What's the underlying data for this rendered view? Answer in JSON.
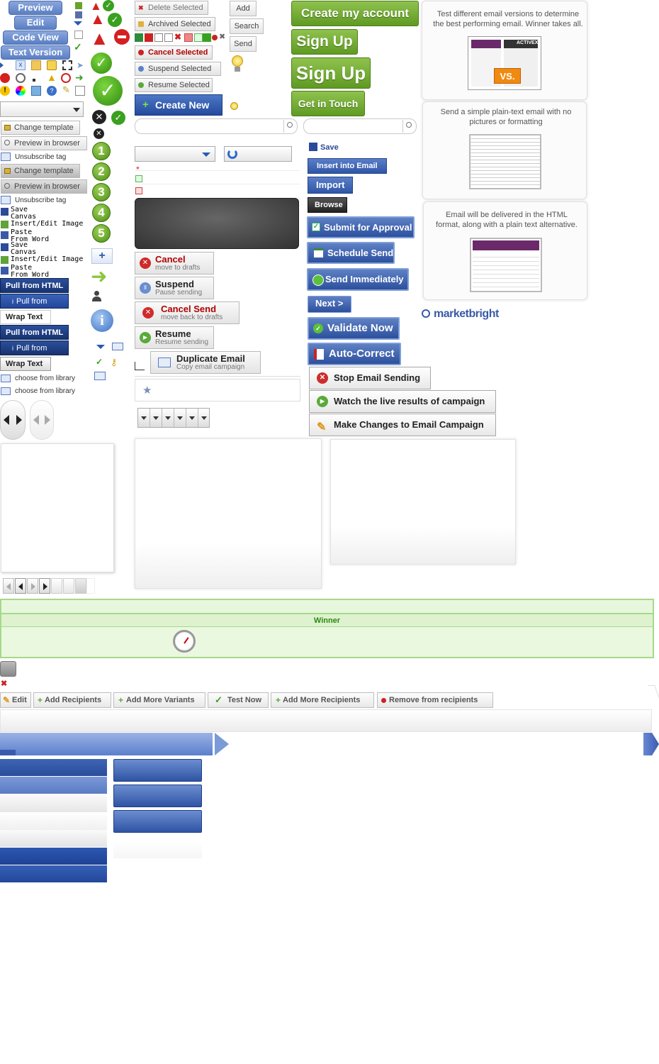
{
  "left_pills": [
    "Preview",
    "Edit",
    "Code View",
    "Text Version"
  ],
  "left_tools": [
    {
      "label": "Change template",
      "style": "light"
    },
    {
      "label": "Preview in browser",
      "style": "light"
    },
    {
      "label": "Unsubscribe tag",
      "style": "plain"
    },
    {
      "label": "Change template",
      "style": "dark"
    },
    {
      "label": "Preview in browser",
      "style": "dark"
    },
    {
      "label": "Unsubscribe tag",
      "style": "plain"
    }
  ],
  "canvas_tools": [
    {
      "l1": "Save",
      "l2": "Canvas"
    },
    {
      "l1": "Insert/Edit Image",
      "l2": ""
    },
    {
      "l1": "Paste",
      "l2": "From Word"
    },
    {
      "l1": "Save",
      "l2": "Canvas"
    },
    {
      "l1": "Insert/Edit Image",
      "l2": ""
    },
    {
      "l1": "Paste",
      "l2": "From Word"
    }
  ],
  "pull_buttons": [
    "Pull from HTML",
    "Pull from HTML",
    "Wrap Text",
    "Pull from HTML",
    "Pull from HTML",
    "Wrap Text"
  ],
  "library_links": [
    "choose from library",
    "choose from library"
  ],
  "step_numbers": [
    "1",
    "2",
    "3",
    "4",
    "5"
  ],
  "action_buttons": [
    {
      "label": "Delete Selected",
      "icon": "x-icon",
      "color": "#cc2222"
    },
    {
      "label": "Archived Selected",
      "icon": "folder-icon",
      "color": "#e0b040"
    },
    {
      "label": "Cancel Selected",
      "icon": "cancel-icon",
      "color": "#cc2222",
      "text_color": "#b00000"
    },
    {
      "label": "Suspend Selected",
      "icon": "pause-icon",
      "color": "#5a82c8"
    },
    {
      "label": "Resume Selected",
      "icon": "play-icon",
      "color": "#5aaa3a"
    }
  ],
  "small_buttons": [
    "Add",
    "Search",
    "Send"
  ],
  "create_new": "Create New",
  "green_buttons": [
    "Create my account",
    "Sign Up",
    "Sign Up",
    "Get in Touch"
  ],
  "status_buttons": [
    {
      "title": "Cancel",
      "sub": "move to drafts",
      "color": "#d02a2a",
      "title_color": "#b00000"
    },
    {
      "title": "Suspend",
      "sub": "Pause sending",
      "color": "#6a8fcf",
      "title_color": "#222"
    },
    {
      "title": "Cancel Send",
      "sub": "move back to drafts",
      "color": "#d02a2a",
      "title_color": "#b00000"
    },
    {
      "title": "Resume",
      "sub": "Resume sending",
      "color": "#5aaa3a",
      "title_color": "#222"
    }
  ],
  "duplicate": {
    "title": "Duplicate Email",
    "sub": "Copy email campaign"
  },
  "save_label": "Save",
  "blue_buttons": [
    "Insert into Email",
    "Import",
    "Browse"
  ],
  "big_blue_buttons": [
    {
      "label": "Submit for Approval",
      "icon": "checkbox-icon"
    },
    {
      "label": "Schedule Send",
      "icon": "calendar-icon"
    },
    {
      "label": "Send Immediately",
      "icon": "send-icon"
    },
    {
      "label": "Next >",
      "icon": ""
    },
    {
      "label": "Validate Now",
      "icon": "check-icon"
    },
    {
      "label": "Auto-Correct",
      "icon": "pdf-icon"
    }
  ],
  "campaign_buttons": [
    {
      "label": "Stop Email Sending",
      "icon": "stop-icon"
    },
    {
      "label": "Watch the live results of campaign",
      "icon": "play-icon"
    },
    {
      "label": "Make Changes to Email Campaign",
      "icon": "pencil-icon"
    }
  ],
  "cards": [
    {
      "text": "Test different email versions  to determine the best performing email. Winner takes all.",
      "badge": "VS.",
      "brand": "ACTIVEX"
    },
    {
      "text": "Send a simple plain-text email with no pictures or formatting"
    },
    {
      "text": "Email will be delivered in the HTML format, along with a plain text alternative."
    }
  ],
  "brand": "marketbright",
  "winner_label": "Winner",
  "toolbar": [
    "Edit",
    "Add Recipients",
    "Add More Variants",
    "Test Now",
    "Add More Recipients",
    "Remove from recipients"
  ],
  "colors": {
    "accent_blue": "#5a7fc4",
    "green": "#6aa22c",
    "red": "#cc2222"
  }
}
